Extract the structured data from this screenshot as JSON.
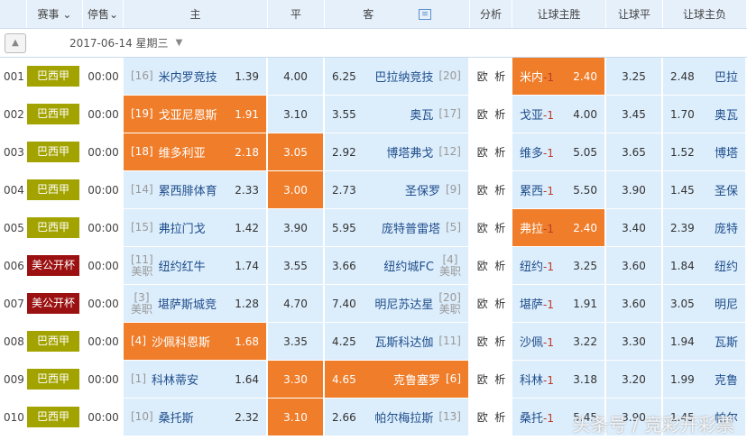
{
  "header": {
    "league": "赛事",
    "stop": "停售",
    "home": "主",
    "draw": "平",
    "away": "客",
    "analysis": "分析",
    "hh_win": "让球主胜",
    "hh_draw": "让球平",
    "hh_lose": "让球主负"
  },
  "date": "2017-06-14 星期三",
  "colors": {
    "brazil": "#a3a300",
    "usopen": "#9b1010",
    "highlight": "#ef7d2a",
    "cell": "#dcedfb"
  },
  "analysis": {
    "ou": "欧",
    "xi": "析"
  },
  "watermark": "头条号 / 竞彩开彩票",
  "rows": [
    {
      "no": "001",
      "league": "巴西甲",
      "lt": "b",
      "time": "00:00",
      "hrank": "[16]",
      "home": "米内罗竞技",
      "hw": "1.39",
      "d": "4.00",
      "aw": "6.25",
      "away": "巴拉纳竞技",
      "arank": "[20]",
      "hs": "米内",
      "hcap": "-1",
      "hhw": "2.40",
      "hhd": "3.25",
      "hhl": "2.48",
      "as": "巴拉",
      "hl": [
        "hh"
      ]
    },
    {
      "no": "002",
      "league": "巴西甲",
      "lt": "b",
      "time": "00:00",
      "hrank": "[19]",
      "home": "戈亚尼恩斯",
      "hw": "1.91",
      "d": "3.10",
      "aw": "3.55",
      "away": "奥瓦",
      "arank": "[17]",
      "hs": "戈亚",
      "hcap": "-1",
      "hhw": "4.00",
      "hhd": "3.45",
      "hhl": "1.70",
      "as": "奥瓦",
      "hl": [
        "home"
      ]
    },
    {
      "no": "003",
      "league": "巴西甲",
      "lt": "b",
      "time": "00:00",
      "hrank": "[18]",
      "home": "维多利亚",
      "hw": "2.18",
      "d": "3.05",
      "aw": "2.92",
      "away": "博塔弗戈",
      "arank": "[12]",
      "hs": "维多",
      "hcap": "-1",
      "hhw": "5.05",
      "hhd": "3.65",
      "hhl": "1.52",
      "as": "博塔",
      "hl": [
        "home",
        "draw"
      ]
    },
    {
      "no": "004",
      "league": "巴西甲",
      "lt": "b",
      "time": "00:00",
      "hrank": "[14]",
      "home": "累西腓体育",
      "hw": "2.33",
      "d": "3.00",
      "aw": "2.73",
      "away": "圣保罗",
      "arank": "[9]",
      "hs": "累西",
      "hcap": "-1",
      "hhw": "5.50",
      "hhd": "3.90",
      "hhl": "1.45",
      "as": "圣保",
      "hl": [
        "draw"
      ]
    },
    {
      "no": "005",
      "league": "巴西甲",
      "lt": "b",
      "time": "00:00",
      "hrank": "[15]",
      "home": "弗拉门戈",
      "hw": "1.42",
      "d": "3.90",
      "aw": "5.95",
      "away": "庞特普雷塔",
      "arank": "[5]",
      "hs": "弗拉",
      "hcap": "-1",
      "hhw": "2.40",
      "hhd": "3.40",
      "hhl": "2.39",
      "as": "庞特",
      "hl": [
        "hh"
      ]
    },
    {
      "no": "006",
      "league": "美公开杯",
      "lt": "u",
      "time": "00:00",
      "hrank": "[11]",
      "hsub": "美职",
      "home": "纽约红牛",
      "hw": "1.74",
      "d": "3.55",
      "aw": "3.66",
      "away": "纽约城FC",
      "arank": "[4]",
      "asub": "美职",
      "hs": "纽约",
      "hcap": "-1",
      "hhw": "3.25",
      "hhd": "3.60",
      "hhl": "1.84",
      "as": "纽约",
      "hl": []
    },
    {
      "no": "007",
      "league": "美公开杯",
      "lt": "u",
      "time": "00:00",
      "hrank": "[3]",
      "hsub": "美职",
      "home": "堪萨斯城竞",
      "hw": "1.28",
      "d": "4.70",
      "aw": "7.40",
      "away": "明尼苏达星",
      "arank": "[20]",
      "asub": "美职",
      "hs": "堪萨",
      "hcap": "-1",
      "hhw": "1.91",
      "hhd": "3.60",
      "hhl": "3.05",
      "as": "明尼",
      "hl": []
    },
    {
      "no": "008",
      "league": "巴西甲",
      "lt": "b",
      "time": "00:00",
      "hrank": "[4]",
      "home": "沙佩科恩斯",
      "hw": "1.68",
      "d": "3.35",
      "aw": "4.25",
      "away": "瓦斯科达伽",
      "arank": "[11]",
      "hs": "沙佩",
      "hcap": "-1",
      "hhw": "3.22",
      "hhd": "3.30",
      "hhl": "1.94",
      "as": "瓦斯",
      "hl": [
        "home"
      ]
    },
    {
      "no": "009",
      "league": "巴西甲",
      "lt": "b",
      "time": "00:00",
      "hrank": "[1]",
      "home": "科林蒂安",
      "hw": "1.64",
      "d": "3.30",
      "aw": "4.65",
      "away": "克鲁塞罗",
      "arank": "[6]",
      "hs": "科林",
      "hcap": "-1",
      "hhw": "3.18",
      "hhd": "3.20",
      "hhl": "1.99",
      "as": "克鲁",
      "hl": [
        "draw",
        "away"
      ]
    },
    {
      "no": "010",
      "league": "巴西甲",
      "lt": "b",
      "time": "00:00",
      "hrank": "[10]",
      "home": "桑托斯",
      "hw": "2.32",
      "d": "3.10",
      "aw": "2.66",
      "away": "帕尔梅拉斯",
      "arank": "[13]",
      "hs": "桑托",
      "hcap": "-1",
      "hhw": "5.45",
      "hhd": "3.90",
      "hhl": "1.45",
      "as": "帕尔",
      "hl": [
        "draw"
      ]
    }
  ]
}
